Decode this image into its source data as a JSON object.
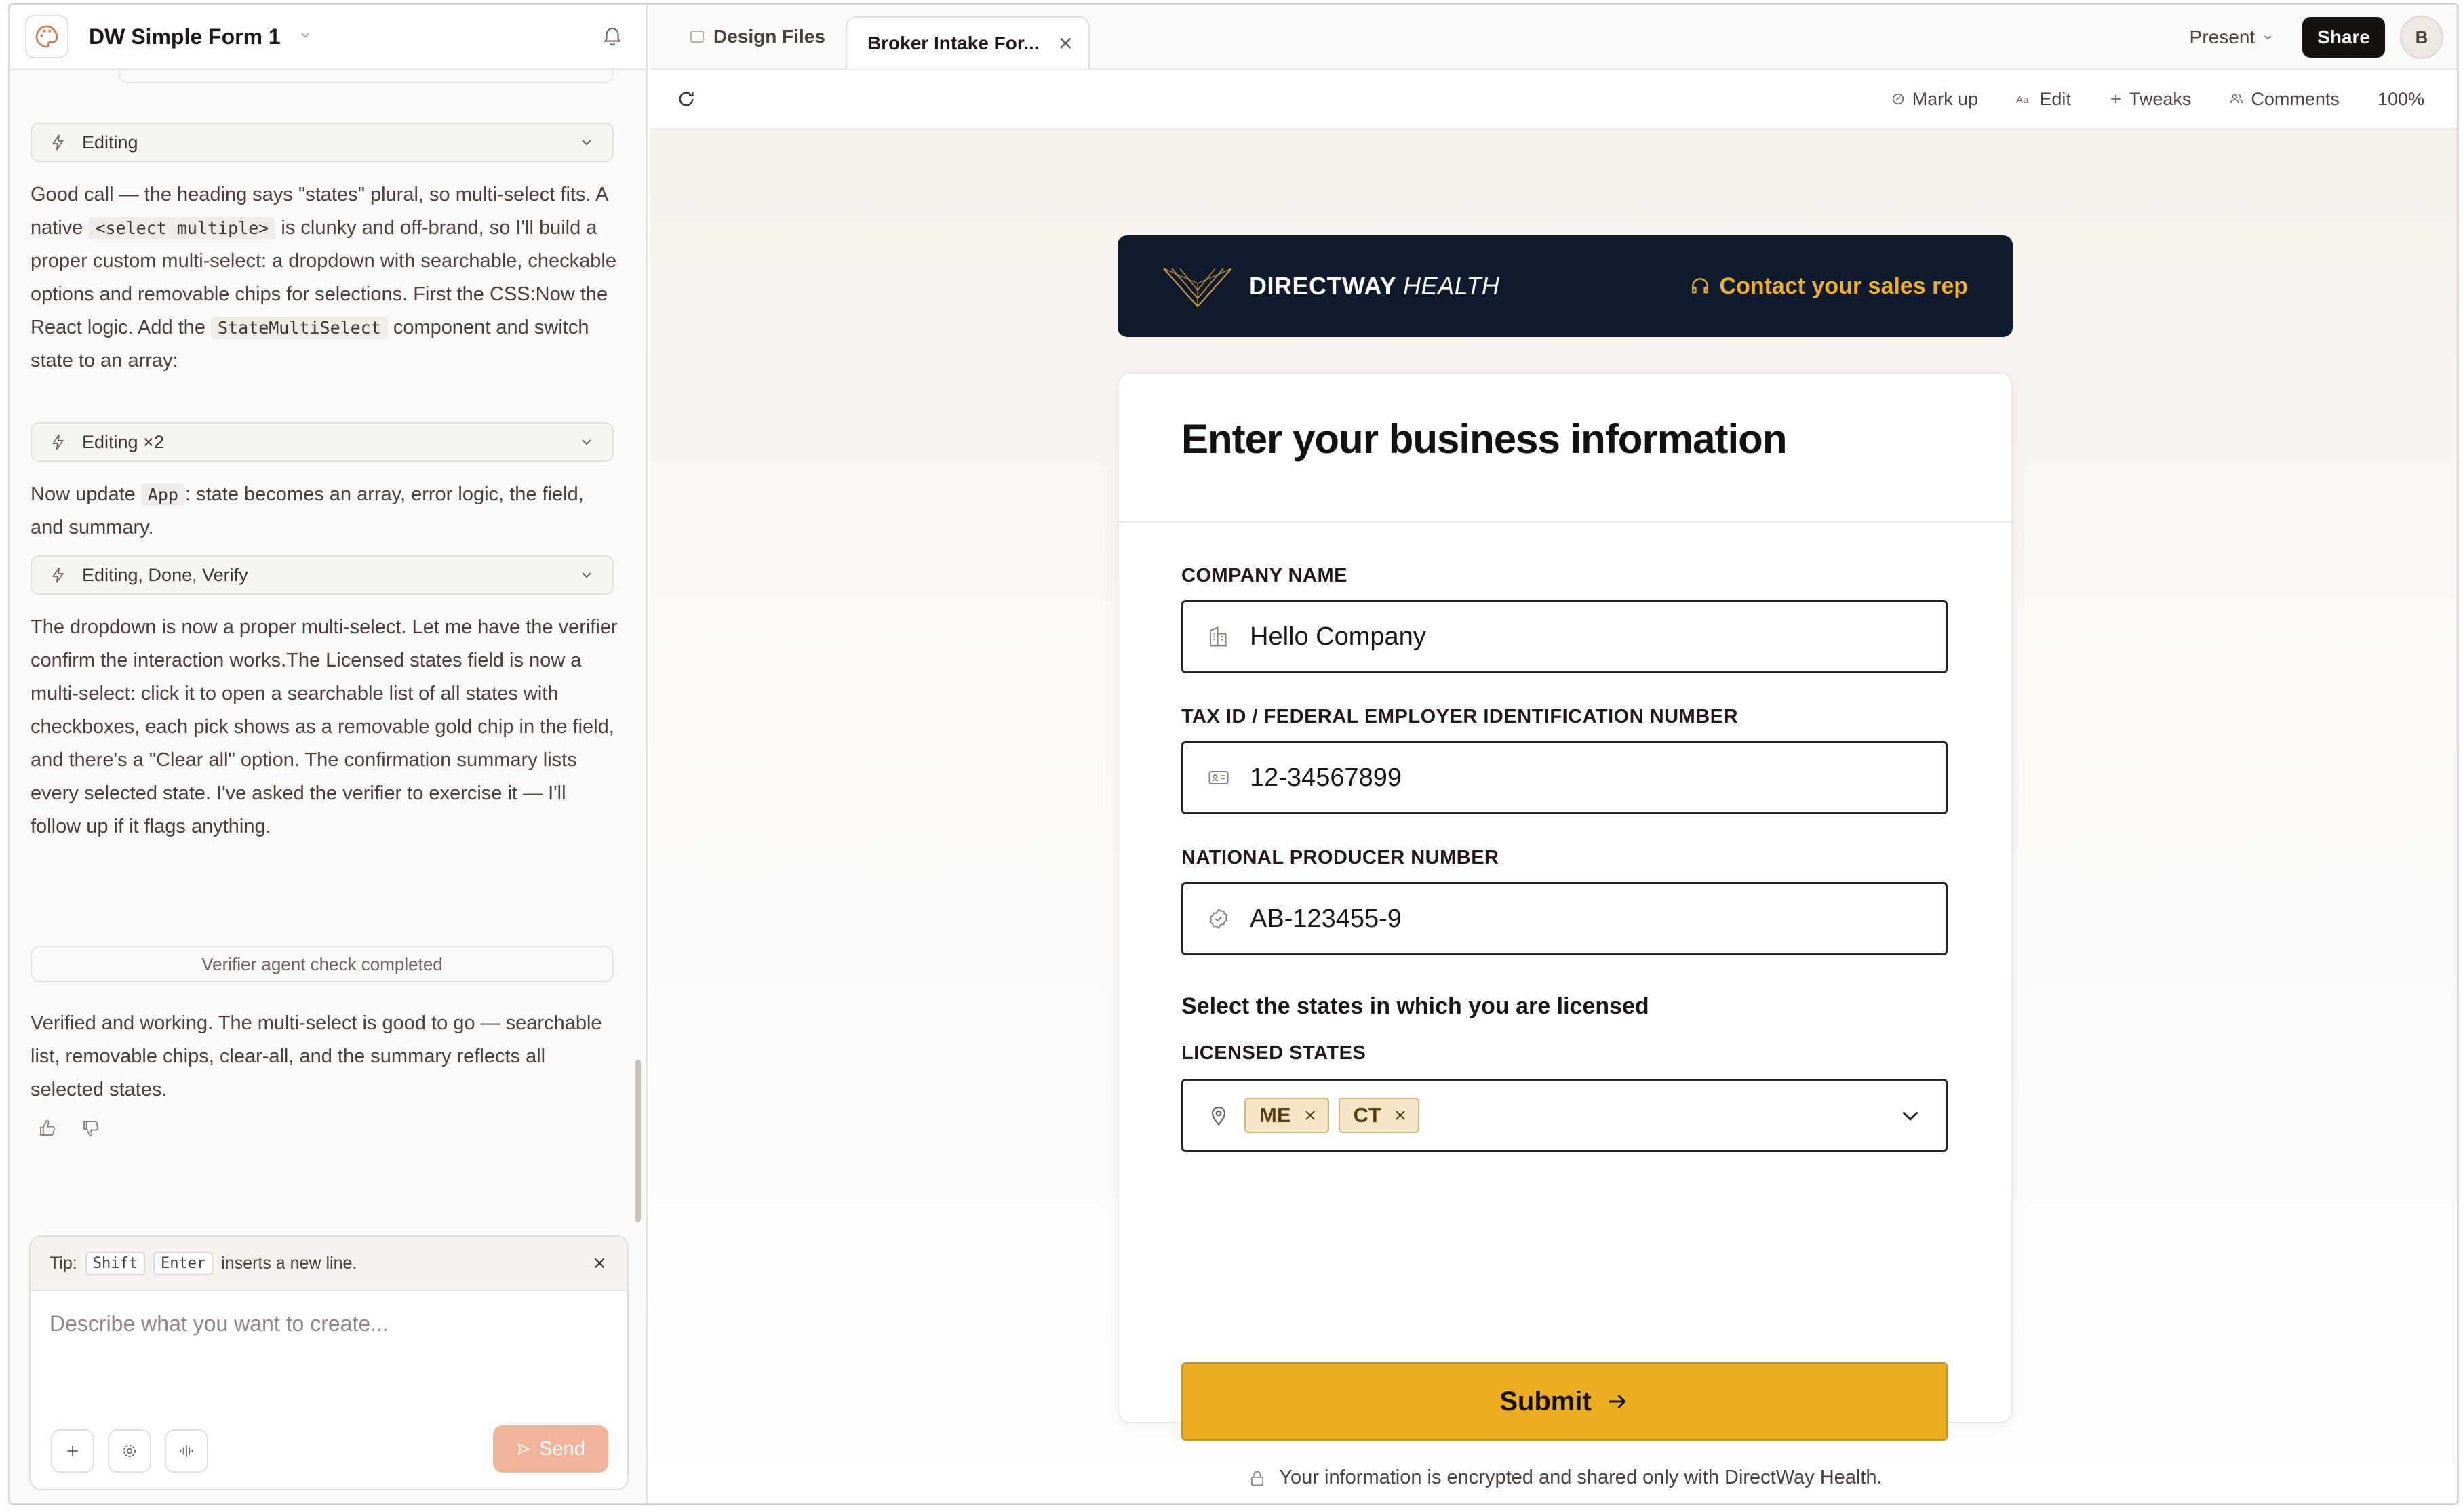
{
  "project": {
    "title": "DW Simple Form 1"
  },
  "chat": {
    "steps": [
      {
        "label": "Editing"
      },
      {
        "label": "Editing ×2"
      },
      {
        "label": "Editing, Done, Verify"
      }
    ],
    "para1": {
      "a": "Good call — the heading says \"states\" plural, so multi-select fits. A native ",
      "code1": "<select multiple>",
      "b": " is clunky and off-brand, so I'll build a proper custom multi-select: a dropdown with searchable, checkable options and removable chips for selections. First the CSS:Now the React logic. Add the ",
      "code2": "StateMultiSelect",
      "c": " component and switch state to an array:"
    },
    "para2": {
      "a": "Now update ",
      "code1": "App",
      "b": ": state becomes an array, error logic, the field, and summary."
    },
    "para3": "The dropdown is now a proper multi-select. Let me have the verifier confirm the interaction works.The Licensed states field is now a multi-select: click it to open a searchable list of all states with checkboxes, each pick shows as a removable gold chip in the field, and there's a \"Clear all\" option. The confirmation summary lists every selected state. I've asked the verifier to exercise it — I'll follow up if it flags anything.",
    "verifier": "Verifier agent check completed",
    "para4": "Verified and working. The multi-select is good to go — searchable list, removable chips, clear-all, and the summary reflects all selected states."
  },
  "composer": {
    "tip_prefix": "Tip:",
    "tip_key1": "Shift",
    "tip_key2": "Enter",
    "tip_suffix": "inserts a new line.",
    "placeholder": "Describe what you want to create...",
    "send_label": "Send"
  },
  "tabs": [
    {
      "label": "Design Files"
    },
    {
      "label": "Broker Intake For..."
    }
  ],
  "topbar": {
    "present_label": "Present",
    "share_label": "Share",
    "avatar_initial": "B"
  },
  "toolbar": {
    "markup": "Mark up",
    "edit": "Edit",
    "tweaks": "Tweaks",
    "comments": "Comments",
    "zoom": "100%"
  },
  "form": {
    "brand_bold": "DIRECTWAY",
    "brand_light": "HEALTH",
    "contact": "Contact your sales rep",
    "title": "Enter your business information",
    "company_label": "COMPANY NAME",
    "company_value": "Hello Company",
    "tax_label": "TAX ID / FEDERAL EMPLOYER IDENTIFICATION NUMBER",
    "tax_value": "12-34567899",
    "npn_label": "NATIONAL PRODUCER NUMBER",
    "npn_value": "AB-123455-9",
    "states_question": "Select the states in which you are licensed",
    "states_label": "LICENSED STATES",
    "states_selected": [
      "ME",
      "CT"
    ],
    "submit_label": "Submit",
    "secure_note": "Your information is encrypted and shared only with DirectWay Health."
  },
  "colors": {
    "accent": "#ecae21",
    "navy": "#0f1b2c",
    "send": "#efb49a"
  }
}
